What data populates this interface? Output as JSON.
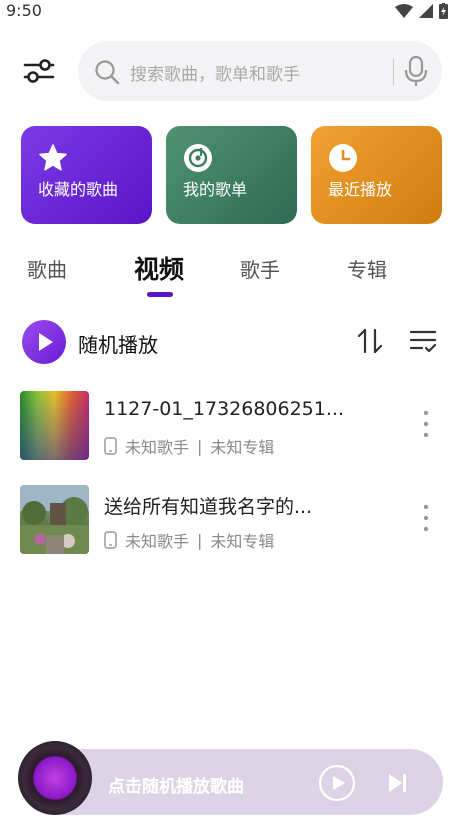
{
  "status_bar": {
    "time": "9:50"
  },
  "search": {
    "placeholder": "搜索歌曲，歌单和歌手"
  },
  "quick_cards": [
    {
      "label": "收藏的歌曲",
      "icon": "star-icon"
    },
    {
      "label": "我的歌单",
      "icon": "music-disc-icon"
    },
    {
      "label": "最近播放",
      "icon": "clock-icon"
    }
  ],
  "tabs": [
    {
      "label": "歌曲",
      "active": false
    },
    {
      "label": "视频",
      "active": true
    },
    {
      "label": "歌手",
      "active": false
    },
    {
      "label": "专辑",
      "active": false
    }
  ],
  "shuffle": {
    "label": "随机播放"
  },
  "songs": [
    {
      "title": "1127-01_17326806251...",
      "artist": "未知歌手",
      "separator": "|",
      "album": "未知专辑"
    },
    {
      "title": "送给所有知道我名字的...",
      "artist": "未知歌手",
      "separator": "|",
      "album": "未知专辑"
    }
  ],
  "player": {
    "label": "点击随机播放歌曲"
  },
  "colors": {
    "accent": "#5a14c8",
    "card_purple": "#6a1bd4",
    "card_green": "#3f7d62",
    "card_orange": "#e08f1f"
  }
}
